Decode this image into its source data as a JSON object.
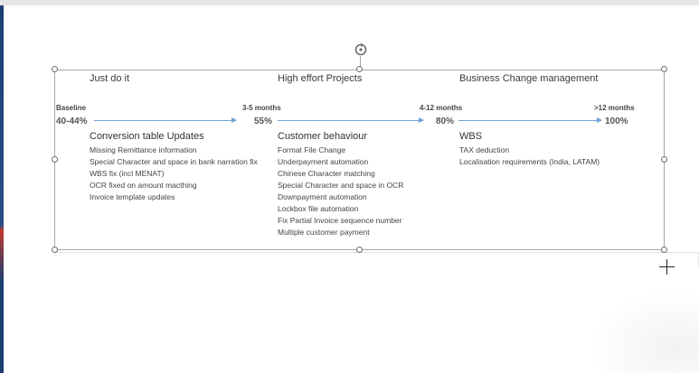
{
  "phases": [
    {
      "title": "Just do it"
    },
    {
      "title": "High effort Projects"
    },
    {
      "title": "Business Change management"
    }
  ],
  "milestones": [
    {
      "label": "Baseline",
      "value": "40-44%"
    },
    {
      "label": "3-5 months",
      "value": "55%"
    },
    {
      "label": "4-12 months",
      "value": "80%"
    },
    {
      "label": ">12 months",
      "value": "100%"
    }
  ],
  "groups": [
    {
      "title": "Conversion table Updates",
      "items": [
        "Missing Remittance information",
        "Special Character and space in bank narration fix",
        "WBS fix (incl MENAT)",
        "OCR fixed on amount macthing",
        "Invoice template updates"
      ]
    },
    {
      "title": "Customer behaviour",
      "items": [
        "Format File Change",
        "Underpayment automation",
        "Chinese Character matching",
        "Special Character and space in OCR",
        "Downpayment automation",
        "Lockbox file automation",
        "Fix Partial Invoice sequence number",
        "Multiple customer payment"
      ]
    },
    {
      "title": "WBS",
      "items": [
        "TAX deduction",
        "Localisation requirements (India, LATAM)"
      ]
    }
  ],
  "colors": {
    "arrow": "#6fa3d6",
    "frame": "#a6a6a6",
    "accent": "#1d3e73"
  },
  "icons": {
    "rotate": "rotate-handle-icon",
    "cursor": "move-crosshair-icon"
  }
}
